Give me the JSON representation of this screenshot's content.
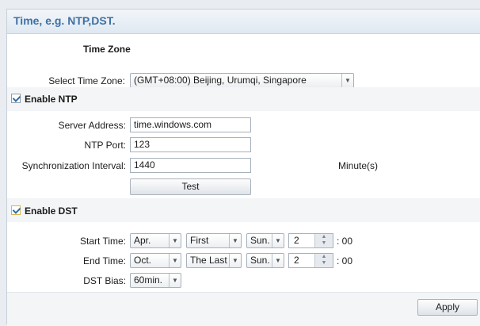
{
  "header": {
    "title": "Time, e.g. NTP,DST."
  },
  "time_zone": {
    "section_title": "Time Zone",
    "select_label": "Select Time Zone:",
    "select_value": "(GMT+08:00) Beijing, Urumqi, Singapore"
  },
  "ntp": {
    "enable_label": "Enable NTP",
    "enabled": true,
    "server_label": "Server Address:",
    "server_value": "time.windows.com",
    "port_label": "NTP Port:",
    "port_value": "123",
    "interval_label": "Synchronization Interval:",
    "interval_value": "1440",
    "interval_unit": "Minute(s)",
    "test_button": "Test"
  },
  "dst": {
    "enable_label": "Enable DST",
    "enabled": true,
    "start_label": "Start Time:",
    "start_month": "Apr.",
    "start_week": "First",
    "start_day": "Sun.",
    "start_hour": "2",
    "start_minutes": ": 00",
    "end_label": "End Time:",
    "end_month": "Oct.",
    "end_week": "The Last",
    "end_day": "Sun.",
    "end_hour": "2",
    "end_minutes": ": 00",
    "bias_label": "DST Bias:",
    "bias_value": "60min."
  },
  "footer": {
    "apply_button": "Apply"
  },
  "icons": {
    "dropdown": "chevron-down-icon",
    "checkbox": "checkmark-icon",
    "spinner": "up-down-arrows-icon"
  },
  "colors": {
    "title": "#3f71a3",
    "header_bg": "#e4ecf4",
    "band_bg": "#f4f5f7",
    "page_bg": "#e9edf1"
  }
}
